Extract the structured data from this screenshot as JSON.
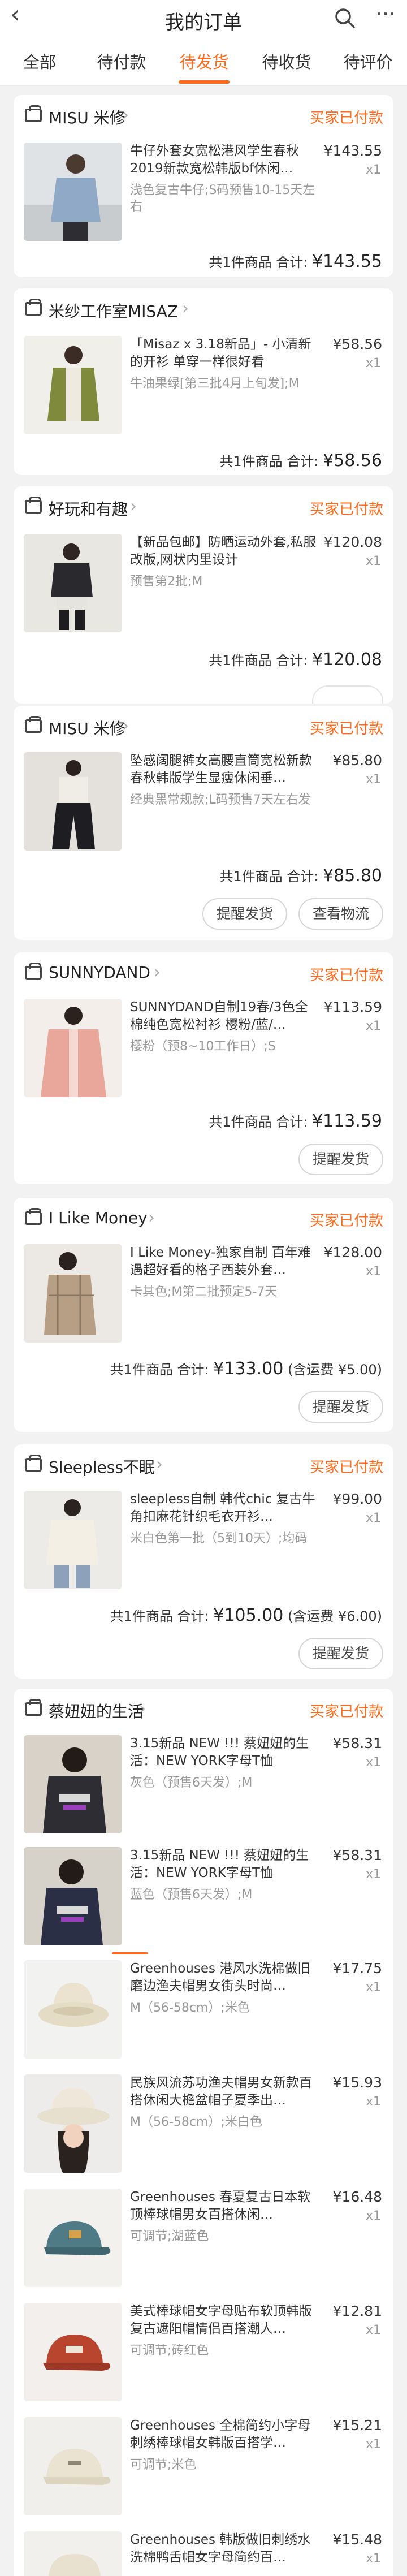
{
  "header": {
    "title": "我的订单"
  },
  "tabs": [
    {
      "label": "全部"
    },
    {
      "label": "待付款"
    },
    {
      "label": "待发货"
    },
    {
      "label": "待收货"
    },
    {
      "label": "待评价"
    }
  ],
  "accent_color": "#ff6a1a",
  "orders": [
    {
      "shop": "MISU 米修",
      "status": "买家已付款",
      "items": [
        {
          "name": "牛仔外套女宽松港风学生春秋2019新款宽松韩版bf休闲…",
          "sku": "浅色复古牛仔;S码预售10-15天左右",
          "price": "¥143.55",
          "qty": "x1"
        }
      ],
      "summary": "共1件商品  合计:",
      "total": "¥143.55"
    },
    {
      "shop": "米纱工作室MISAZ",
      "status": "",
      "items": [
        {
          "name": "「Misaz x 3.18新品」- 小清新的开衫 单穿一样很好看",
          "sku": "牛油果绿[第三批4月上旬发];M",
          "price": "¥58.56",
          "qty": "x1"
        }
      ],
      "summary": "共1件商品  合计:",
      "total": "¥58.56"
    },
    {
      "shop": "好玩和有趣",
      "status": "买家已付款",
      "items": [
        {
          "name": "【新品包邮】防晒运动外套,私服改版,网状内里设计",
          "sku": "预售第2批;M",
          "price": "¥120.08",
          "qty": "x1"
        }
      ],
      "summary": "共1件商品  合计:",
      "total": "¥120.08"
    },
    {
      "shop": "MISU 米修",
      "status": "买家已付款",
      "items": [
        {
          "name": "坠感阔腿裤女高腰直筒宽松新款春秋韩版学生显瘦休闲垂…",
          "sku": "经典黑常规款;L码预售7天左右发",
          "price": "¥85.80",
          "qty": "x1"
        }
      ],
      "summary": "共1件商品  合计:",
      "total": "¥85.80",
      "buttons": [
        "提醒发货",
        "查看物流"
      ]
    },
    {
      "shop": "SUNNYDAND",
      "status": "买家已付款",
      "items": [
        {
          "name": "SUNNYDAND自制19春/3色全棉纯色宽松衬衫 樱粉/蓝/…",
          "sku": "樱粉（预8~10工作日）;S",
          "price": "¥113.59",
          "qty": "x1"
        }
      ],
      "summary": "共1件商品  合计:",
      "total": "¥113.59",
      "buttons": [
        "提醒发货"
      ]
    },
    {
      "shop": "I Like Money",
      "status": "买家已付款",
      "items": [
        {
          "name": "I Like Money-独家自制 百年难遇超好看的格子西装外套…",
          "sku": "卡其色;M第二批预定5-7天",
          "price": "¥128.00",
          "qty": "x1"
        }
      ],
      "summary": "共1件商品  合计:",
      "total": "¥133.00",
      "freight": "(含运费 ¥5.00)",
      "buttons": [
        "提醒发货"
      ]
    },
    {
      "shop": "Sleepless不眠",
      "status": "买家已付款",
      "items": [
        {
          "name": "sleepless自制 韩代chic 复古牛角扣麻花针织毛衣开衫…",
          "sku": "米白色第一批（5到10天）;均码",
          "price": "¥99.00",
          "qty": "x1"
        }
      ],
      "summary": "共1件商品  合计:",
      "total": "¥105.00",
      "freight": "(含运费 ¥6.00)",
      "buttons": [
        "提醒发货"
      ]
    },
    {
      "shop": "蔡妞妞的生活",
      "status": "买家已付款",
      "items": [
        {
          "name": "3.15新品 NEW !!! 蔡妞妞的生活：NEW YORK字母T恤",
          "sku": "灰色（预售6天发）;M",
          "price": "¥58.31",
          "qty": "x1"
        },
        {
          "name": "3.15新品 NEW !!! 蔡妞妞的生活：NEW YORK字母T恤",
          "sku": "蓝色（预售6天发）;M",
          "price": "¥58.31",
          "qty": "x1"
        },
        {
          "name": "Greenhouses 港风水洗棉做旧磨边渔夫帽男女街头时尚…",
          "sku": "M（56-58cm）;米色",
          "price": "¥17.75",
          "qty": "x1"
        },
        {
          "name": "民族风流苏功渔夫帽男女新款百搭休闲大檐盆帽子夏季出…",
          "sku": "M（56-58cm）;米白色",
          "price": "¥15.93",
          "qty": "x1"
        },
        {
          "name": "Greenhouses 春夏复古日本软顶棒球帽男女百搭休闲…",
          "sku": "可调节;湖蓝色",
          "price": "¥16.48",
          "qty": "x1"
        },
        {
          "name": "美式棒球帽女字母贴布软顶韩版复古遮阳帽情侣百搭潮人…",
          "sku": "可调节;砖红色",
          "price": "¥12.81",
          "qty": "x1"
        },
        {
          "name": "Greenhouses 全棉简约小字母刺绣棒球帽女韩版百搭学…",
          "sku": "可调节;米色",
          "price": "¥15.21",
          "qty": "x1"
        },
        {
          "name": "Greenhouses 韩版做旧刺绣水洗棉鸭舌帽女字母简约百…",
          "sku": "",
          "price": "¥15.48",
          "qty": "x1"
        }
      ]
    }
  ]
}
